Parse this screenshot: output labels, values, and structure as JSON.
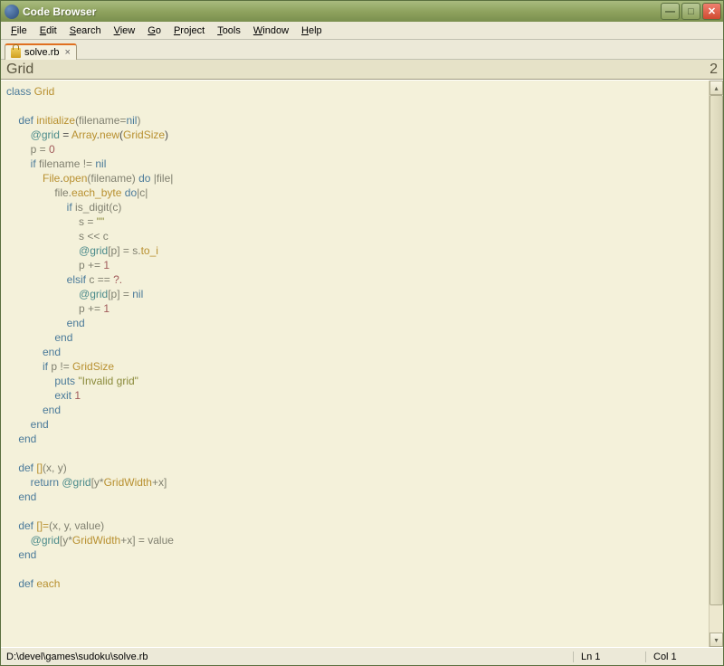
{
  "window": {
    "title": "Code Browser"
  },
  "menu": {
    "file": "File",
    "edit": "Edit",
    "search": "Search",
    "view": "View",
    "go": "Go",
    "project": "Project",
    "tools": "Tools",
    "window": "Window",
    "help": "Help"
  },
  "tab": {
    "label": "solve.rb",
    "close": "×"
  },
  "section": {
    "title": "Grid",
    "count": "2"
  },
  "code": {
    "L0": "class",
    "L0b": " Grid",
    "L1": "",
    "L2a": "    def",
    "L2b": " initialize",
    "L2c": "(filename=",
    "L2d": "nil",
    "L2e": ")",
    "L3a": "        ",
    "L3b": "@grid",
    "L3c": " = ",
    "L3d": "Array",
    "L3e": ".",
    "L3f": "new",
    "L3g": "(",
    "L3h": "GridSize",
    "L3i": ")",
    "L4a": "        p = ",
    "L4b": "0",
    "L5a": "        if",
    "L5b": " filename != ",
    "L5c": "nil",
    "L6a": "            ",
    "L6b": "File",
    "L6c": ".",
    "L6d": "open",
    "L6e": "(filename) ",
    "L6f": "do",
    "L6g": " |file|",
    "L7a": "                file.",
    "L7b": "each_byte",
    "L7c": " ",
    "L7d": "do",
    "L7e": "|c|",
    "L8a": "                    if",
    "L8b": " is_digit(c)",
    "L9a": "                        s = ",
    "L9b": "\"\"",
    "L10a": "                        s << c",
    "L11a": "                        ",
    "L11b": "@grid",
    "L11c": "[p] = s.",
    "L11d": "to_i",
    "L12a": "                        p += ",
    "L12b": "1",
    "L13a": "                    elsif",
    "L13b": " c == ",
    "L13c": "?.",
    "L14a": "                        ",
    "L14b": "@grid",
    "L14c": "[p] = ",
    "L14d": "nil",
    "L15a": "                        p += ",
    "L15b": "1",
    "L16a": "                    end",
    "L17a": "                end",
    "L18a": "            end",
    "L19a": "            if",
    "L19b": " p != ",
    "L19c": "GridSize",
    "L20a": "                puts",
    "L20b": " ",
    "L20c": "\"Invalid grid\"",
    "L21a": "                exit",
    "L21b": " ",
    "L21c": "1",
    "L22a": "            end",
    "L23a": "        end",
    "L24a": "    end",
    "L25": "",
    "L26a": "    def",
    "L26b": " []",
    "L26c": "(x, y)",
    "L27a": "        return",
    "L27b": " ",
    "L27c": "@grid",
    "L27d": "[y*",
    "L27e": "GridWidth",
    "L27f": "+x]",
    "L28a": "    end",
    "L29": "",
    "L30a": "    def",
    "L30b": " []=",
    "L30c": "(x, y, value)",
    "L31a": "        ",
    "L31b": "@grid",
    "L31c": "[y*",
    "L31d": "GridWidth",
    "L31e": "+x] = value",
    "L32a": "    end",
    "L33": "",
    "L34a": "    def",
    "L34b": " each"
  },
  "status": {
    "path": "D:\\devel\\games\\sudoku\\solve.rb",
    "ln": "Ln 1",
    "col": "Col 1"
  }
}
